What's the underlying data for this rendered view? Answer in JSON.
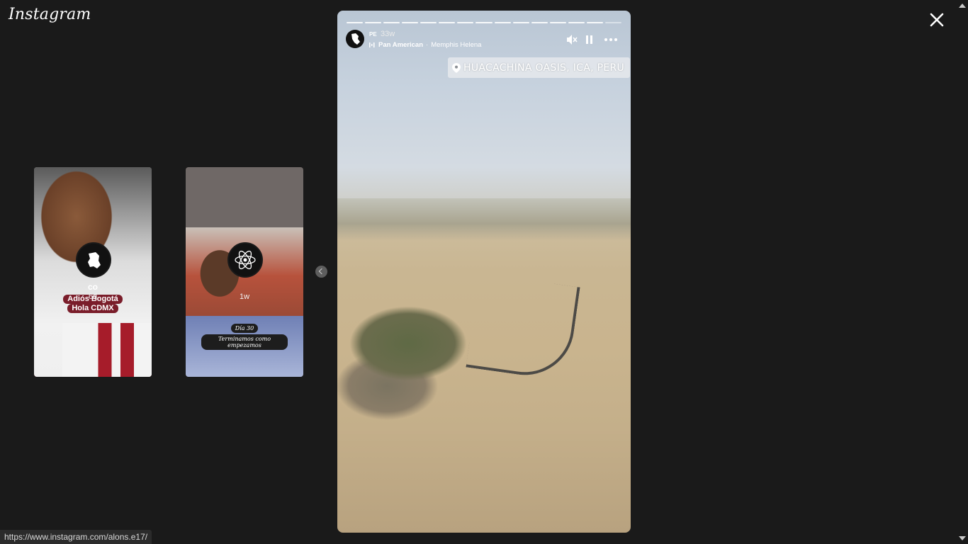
{
  "app": {
    "logo_text": "Instagram"
  },
  "previews": [
    {
      "username": "co",
      "time": "6d",
      "sticker_lines": [
        "Adiós Bogotá",
        "Hola CDMX"
      ]
    },
    {
      "username": "",
      "time": "1w",
      "caption_lines": [
        "Día 30",
        "Terminamos como empezamos"
      ]
    }
  ],
  "story": {
    "username": "PE",
    "time": "33w",
    "music": {
      "artist": "Pan American",
      "separator": "·",
      "title": "Memphis Helena"
    },
    "location": "HUACACHINA OASIS, ICA, PERU",
    "segments": 15,
    "current_segment": 15
  },
  "status_bar": {
    "url": "https://www.instagram.com/alons.e17/"
  },
  "icons": {
    "close": "close-icon",
    "mute": "speaker-muted-icon",
    "pause": "pause-icon",
    "more": "more-options-icon",
    "location_pin": "location-pin-icon",
    "music": "music-note-icon",
    "prev": "chevron-left-icon"
  },
  "colors": {
    "background": "#1a1a1a",
    "progress": "#ffffff",
    "sticker": "#7a1d2a"
  }
}
